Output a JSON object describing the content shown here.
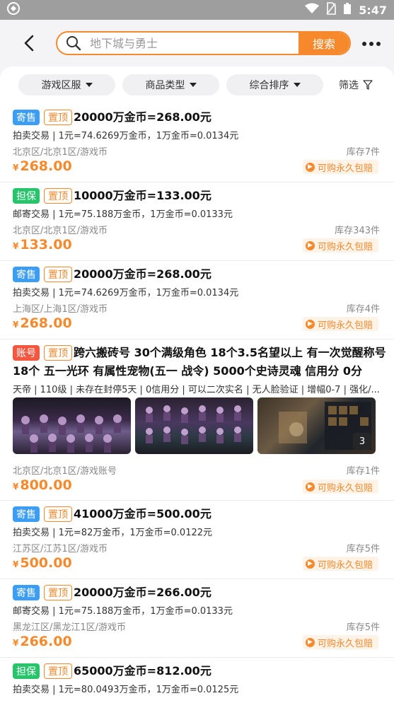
{
  "status_bar": {
    "time": "5:47"
  },
  "search": {
    "placeholder": "地下城与勇士",
    "button_label": "搜索"
  },
  "filters": [
    "游戏区服",
    "商品类型",
    "综合排序"
  ],
  "screen_label": "筛选",
  "guarantee_label": "可购永久包赔",
  "items": [
    {
      "tag": "寄售",
      "top": "置顶",
      "title": "20000万金币=268.00元",
      "meta": "拍卖交易 | 1元=74.6269万金币，1万金币=0.0134元",
      "location": "北京区/北京1区/游戏币",
      "stock": "库存7件",
      "price": "268.00"
    },
    {
      "tag": "担保",
      "top": "置顶",
      "title": "10000万金币=133.00元",
      "meta": "邮寄交易 | 1元=75.188万金币，1万金币=0.0133元",
      "location": "北京区/北京1区/游戏币",
      "stock": "库存343件",
      "price": "133.00"
    },
    {
      "tag": "寄售",
      "top": "置顶",
      "title": "20000万金币=268.00元",
      "meta": "拍卖交易 | 1元=74.6269万金币，1万金币=0.0134元",
      "location": "上海区/上海1区/游戏币",
      "stock": "库存4件",
      "price": "268.00"
    },
    {
      "tag": "账号",
      "top": "置顶",
      "title_line1": "跨六搬砖号 30个满级角色 18个3.5名望以上 有一次觉醒称号",
      "title_line2": "18个 五一光环 有属性宠物(五一 战令) 5000个史诗灵魂 信用分 0分",
      "meta": "天帝 | 110级 | 未存在封停5天 | 0信用分 | 可以二次实名 | 无人脸验证 | 增幅0-7 | 强化/...",
      "location": "北京区/北京1区/游戏账号",
      "stock": "库存1件",
      "price": "800.00",
      "image_count": "3"
    },
    {
      "tag": "寄售",
      "top": "置顶",
      "title": "41000万金币=500.00元",
      "meta": "拍卖交易 | 1元=82万金币，1万金币=0.0122元",
      "location": "江苏区/江苏1区/游戏币",
      "stock": "库存5件",
      "price": "500.00"
    },
    {
      "tag": "寄售",
      "top": "置顶",
      "title": "20000万金币=266.00元",
      "meta": "邮寄交易 | 1元=75.188万金币，1万金币=0.0133元",
      "location": "黑龙江区/黑龙江1区/游戏币",
      "stock": "库存5件",
      "price": "266.00"
    },
    {
      "tag": "担保",
      "top": "置顶",
      "title": "65000万金币=812.00元",
      "meta": "拍卖交易 | 1元=80.0493万金币，1万金币=0.0125元"
    }
  ],
  "currency_symbol": "¥",
  "colors": {
    "accent": "#f7892d",
    "sell_tag": "#3b9df3",
    "guarantee_tag": "#27c46b",
    "account_tag": "#f4563f"
  }
}
